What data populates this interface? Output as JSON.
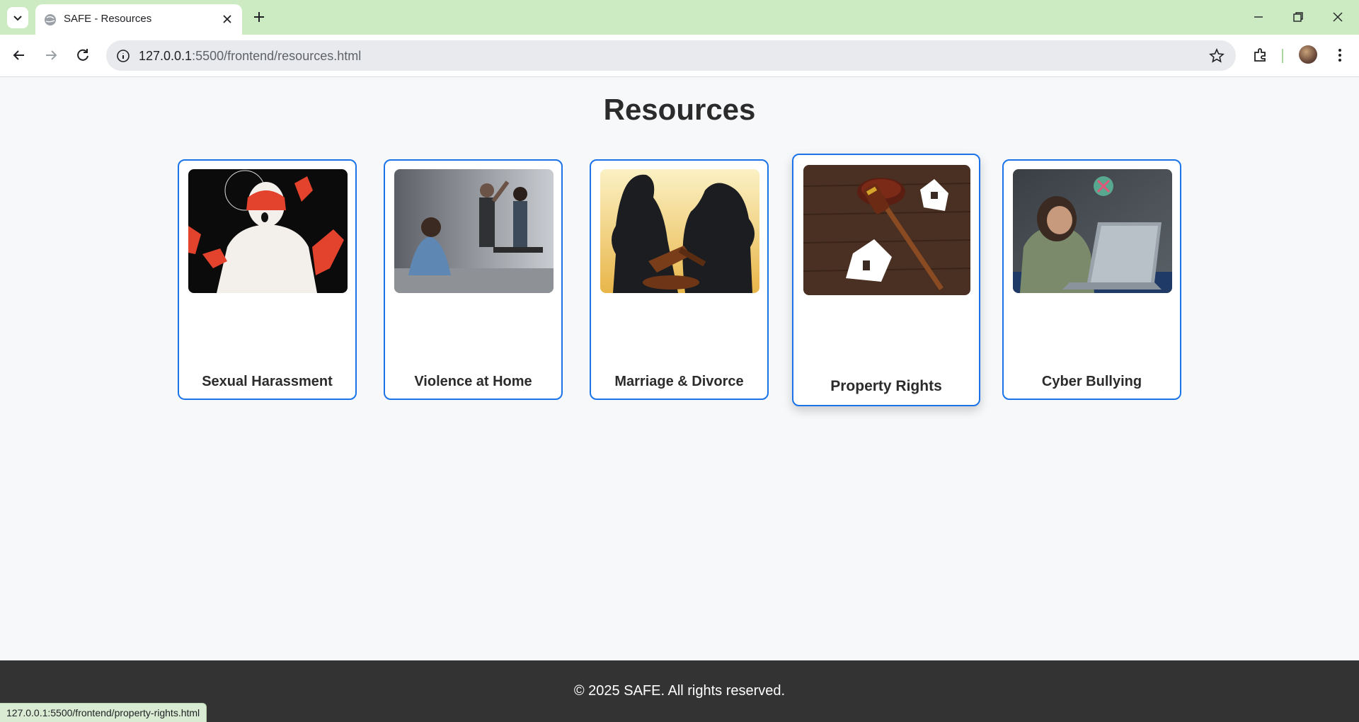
{
  "browser": {
    "tab_title": "SAFE - Resources",
    "url_host": "127.0.0.1",
    "url_rest": ":5500/frontend/resources.html",
    "status_url": "127.0.0.1:5500/frontend/property-rights.html"
  },
  "page": {
    "title": "Resources",
    "cards": [
      {
        "label": "Sexual Harassment",
        "image": "sexual-harassment-illustration"
      },
      {
        "label": "Violence at Home",
        "image": "domestic-violence-photo"
      },
      {
        "label": "Marriage & Divorce",
        "image": "couple-silhouette-gavel"
      },
      {
        "label": "Property Rights",
        "image": "gavel-paper-houses",
        "hovered": true
      },
      {
        "label": "Cyber Bullying",
        "image": "girl-at-laptop-photo"
      }
    ]
  },
  "footer": {
    "text": "© 2025 SAFE. All rights reserved."
  },
  "colors": {
    "tabstrip": "#cdebc3",
    "card_border": "#1a73e8",
    "footer_bg": "#333333"
  }
}
